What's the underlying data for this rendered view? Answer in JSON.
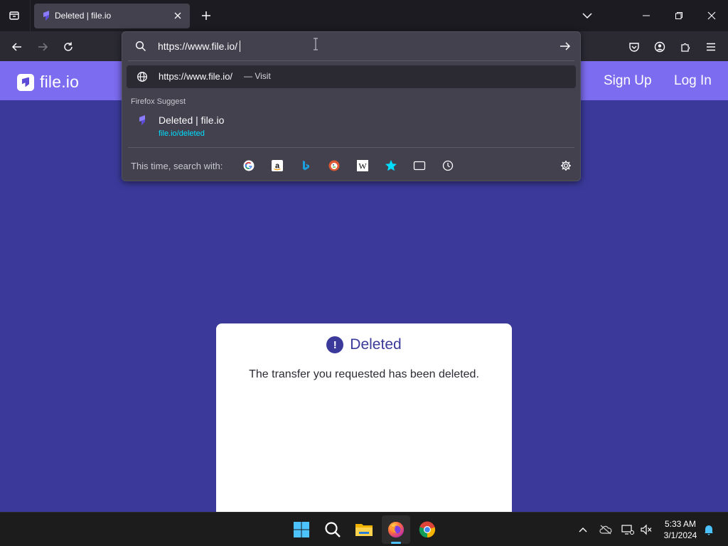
{
  "browser": {
    "tab": {
      "title": "Deleted | file.io",
      "favicon": "file-io-favicon"
    },
    "url_input": {
      "value": "https://www.file.io/"
    },
    "dropdown": {
      "visit": {
        "url": "https://www.file.io/",
        "suffix": "— Visit"
      },
      "suggest_header": "Firefox Suggest",
      "suggestion": {
        "title": "Deleted | file.io",
        "url": "file.io/deleted"
      },
      "engines_label": "This time, search with:",
      "engines": [
        "google-icon",
        "amazon-icon",
        "bing-icon",
        "duckduckgo-icon",
        "wikipedia-icon",
        "bookmarks-icon",
        "tabs-icon",
        "history-icon"
      ]
    }
  },
  "site": {
    "logo_text": "file.io",
    "header_links": {
      "signup": "Sign Up",
      "login": "Log In"
    },
    "card": {
      "title": "Deleted",
      "message": "The transfer you requested has been deleted."
    }
  },
  "taskbar": {
    "time": "5:33 AM",
    "date": "3/1/2024"
  },
  "colors": {
    "site_bg": "#3b3a9b",
    "header_bg": "#7c6cf0",
    "link_cyan": "#00ddff",
    "chrome_dark": "#1c1b22"
  }
}
